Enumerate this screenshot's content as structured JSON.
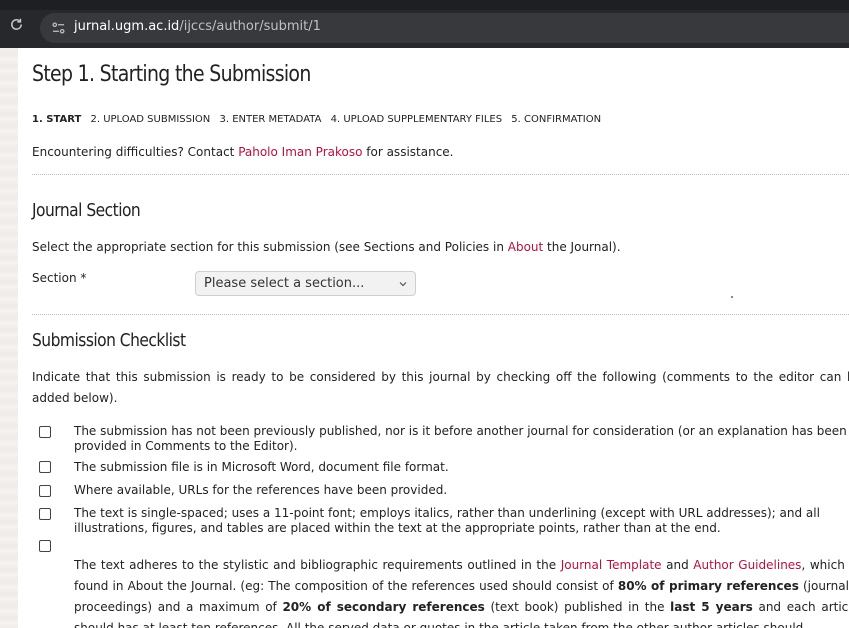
{
  "browser": {
    "url_host": "jurnal.ugm.ac.id",
    "url_path": "/ijccs/author/submit/1"
  },
  "page": {
    "title": "Step 1. Starting the Submission",
    "steps": [
      "1. START",
      "2. UPLOAD SUBMISSION",
      "3. ENTER METADATA",
      "4. UPLOAD SUPPLEMENTARY FILES",
      "5. CONFIRMATION"
    ],
    "difficulty_prefix": "Encountering difficulties? Contact ",
    "contact_name": "Paholo Iman Prakoso",
    "difficulty_suffix": " for assistance."
  },
  "journal_section": {
    "heading": "Journal Section",
    "intro_prefix": "Select the appropriate section for this submission (see Sections and Policies in ",
    "about_link": "About",
    "intro_suffix": " the Journal).",
    "section_label": "Section *",
    "select_value": "Please select a section..."
  },
  "checklist": {
    "heading": "Submission Checklist",
    "intro": "Indicate that this submission is ready to be considered by this journal by checking off the following (comments to the editor can be added below).",
    "items": [
      "The submission has not been previously published, nor is it before another journal for consideration (or an explanation has been provided in Comments to the Editor).",
      "The submission file is in Microsoft Word, document file format.",
      "Where available, URLs for the references have been provided.",
      "The text is single-spaced; uses a 11-point font; employs italics, rather than underlining (except with URL addresses); and all illustrations, figures, and tables are placed within the text at the appropriate points, rather than at the end."
    ],
    "item5": {
      "p1": "The text adheres to the stylistic and bibliographic requirements outlined in the ",
      "link1": "Journal Template",
      "p2": " and ",
      "link2": "Author Guidelines",
      "p3": ", which is found in About the Journal. (eg: The composition of the references used should consist of ",
      "b1": "80% of primary references",
      "p4": " (journals, proceedings) and a maximum of ",
      "b2": "20% of secondary references",
      "p5": " (text book) published in the ",
      "b3": "last 5 years",
      "p6": " and each article should has at least ten references. All the served data or quotes in the article taken from the other author articles should"
    }
  }
}
